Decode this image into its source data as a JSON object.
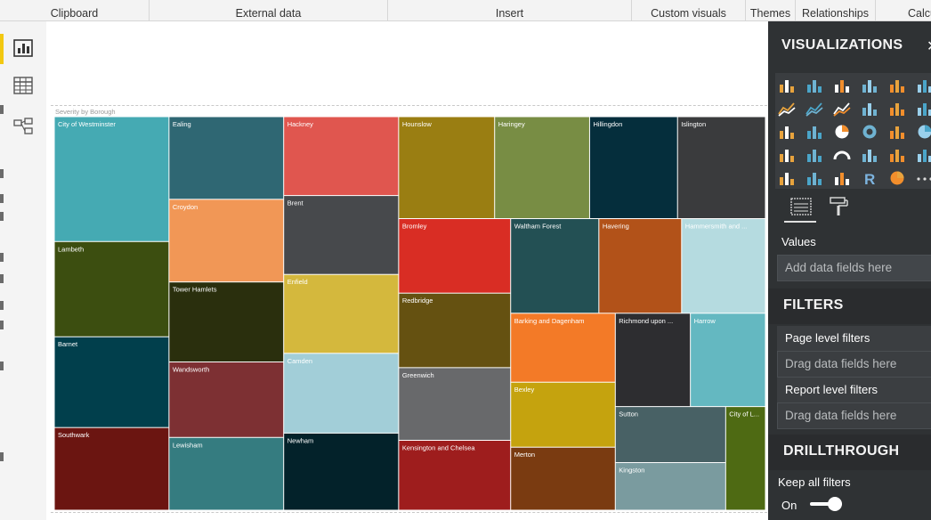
{
  "ribbon": {
    "groups": [
      "Clipboard",
      "External data",
      "Insert",
      "Custom visuals",
      "Themes",
      "Relationships",
      "Calcu"
    ]
  },
  "left_rail": {
    "items": [
      {
        "icon": "report-view-icon",
        "active": true
      },
      {
        "icon": "data-view-icon",
        "active": false
      },
      {
        "icon": "relationships-view-icon",
        "active": false
      }
    ]
  },
  "visual": {
    "title": "Severity by Borough"
  },
  "chart_data": {
    "type": "treemap",
    "title": "Severity by Borough",
    "columns": [
      {
        "items": [
          {
            "name": "City of Westminster",
            "weight": 139,
            "color": "#45aab3"
          },
          {
            "name": "Lambeth",
            "weight": 106,
            "color": "#3c4e10"
          },
          {
            "name": "Barnet",
            "weight": 101,
            "color": "#013f4c"
          },
          {
            "name": "Southwark",
            "weight": 92,
            "color": "#6b1511"
          }
        ]
      },
      {
        "items": [
          {
            "name": "Ealing",
            "weight": 92,
            "color": "#2f6773"
          },
          {
            "name": "Croydon",
            "weight": 92,
            "color": "#f19756"
          },
          {
            "name": "Tower Hamlets",
            "weight": 89,
            "color": "#2a2f0d"
          },
          {
            "name": "Wandsworth",
            "weight": 84,
            "color": "#7d3033"
          },
          {
            "name": "Lewisham",
            "weight": 81,
            "color": "#357c80"
          }
        ]
      },
      {
        "items": [
          {
            "name": "Hackney",
            "weight": 88,
            "color": "#e0564f"
          },
          {
            "name": "Brent",
            "weight": 88,
            "color": "#47494c"
          },
          {
            "name": "Enfield",
            "weight": 88,
            "color": "#d4b83d"
          },
          {
            "name": "Camden",
            "weight": 89,
            "color": "#a2ced8"
          },
          {
            "name": "Newham",
            "weight": 86,
            "color": "#03222a"
          }
        ]
      },
      {
        "group": [
          {
            "items": [
              {
                "name": "Hounslow",
                "weight": 95,
                "color": "#9a7e12"
              },
              {
                "name": "Haringey",
                "weight": 94,
                "color": "#788d44"
              },
              {
                "name": "Hillingdon",
                "weight": 87,
                "color": "#052e3c"
              },
              {
                "name": "Islington",
                "weight": 87,
                "color": "#3a3b3d"
              }
            ]
          },
          {
            "columns": [
              {
                "items": [
                  {
                    "name": "Bromley",
                    "weight": 81,
                    "color": "#d92d24"
                  },
                  {
                    "name": "Redbridge",
                    "weight": 81,
                    "color": "#655111"
                  },
                  {
                    "name": "Greenwich",
                    "weight": 79,
                    "color": "#68696b"
                  },
                  {
                    "name": "Kensington and Chelsea",
                    "weight": 76,
                    "color": "#9e1d1d"
                  }
                ]
              },
              {
                "rows": [
                  {
                    "items": [
                      {
                        "name": "Waltham Forest",
                        "weight": 81,
                        "color": "#235054"
                      },
                      {
                        "name": "Havering",
                        "weight": 76,
                        "color": "#b25219"
                      },
                      {
                        "name": "Hammersmith and ...",
                        "weight": 77,
                        "color": "#b5dbe0"
                      }
                    ]
                  },
                  {
                    "columns": [
                      {
                        "items": [
                          {
                            "name": "Barking and Dagenham",
                            "weight": 70,
                            "color": "#f37a27"
                          },
                          {
                            "name": "Bexley",
                            "weight": 66,
                            "color": "#c5a30e"
                          },
                          {
                            "name": "Merton",
                            "weight": 64,
                            "color": "#7a3b11"
                          }
                        ]
                      },
                      {
                        "rows": [
                          {
                            "items": [
                              {
                                "name": "Richmond upon ...",
                                "weight": 68,
                                "color": "#2d2d30"
                              },
                              {
                                "name": "Harrow",
                                "weight": 68,
                                "color": "#64b8c1"
                              }
                            ]
                          },
                          {
                            "columns": [
                              {
                                "items": [
                                  {
                                    "name": "Sutton",
                                    "weight": 60,
                                    "color": "#486165"
                                  },
                                  {
                                    "name": "Kingston",
                                    "weight": 51,
                                    "color": "#7a9b9f"
                                  }
                                ]
                              },
                              {
                                "items": [
                                  {
                                    "name": "City of L...",
                                    "weight": 40,
                                    "color": "#4e6a13"
                                  }
                                ]
                              }
                            ]
                          }
                        ]
                      }
                    ]
                  }
                ]
              }
            ]
          }
        ]
      }
    ]
  },
  "pane": {
    "title": "VISUALIZATIONS",
    "values_label": "Values",
    "values_placeholder": "Add data fields here",
    "filters_title": "FILTERS",
    "page_filters_label": "Page level filters",
    "page_filters_placeholder": "Drag data fields here",
    "report_filters_label": "Report level filters",
    "report_filters_placeholder": "Drag data fields here",
    "drillthrough_title": "DRILLTHROUGH",
    "keep_filters_label": "Keep all filters",
    "toggle_state": "On",
    "viz_icons": [
      "stacked-bar-icon",
      "stacked-column-icon",
      "clustered-bar-icon",
      "clustered-column-icon",
      "100-percent-bar-icon",
      "100-percent-column-icon",
      "line-chart-icon",
      "area-chart-icon",
      "stacked-area-icon",
      "line-column-icon",
      "line-stacked-column-icon",
      "ribbon-chart-icon",
      "waterfall-icon",
      "scatter-icon",
      "pie-chart-icon",
      "donut-chart-icon",
      "treemap-icon",
      "map-icon",
      "filled-map-icon",
      "funnel-icon",
      "gauge-icon",
      "card-icon",
      "multi-row-card-icon",
      "kpi-icon",
      "slicer-icon",
      "table-icon",
      "matrix-icon",
      "r-visual-icon",
      "arcgis-icon",
      "more-visuals-icon"
    ],
    "colors": {
      "accent": "#f2c811",
      "pane_bg": "#2f3234"
    }
  }
}
